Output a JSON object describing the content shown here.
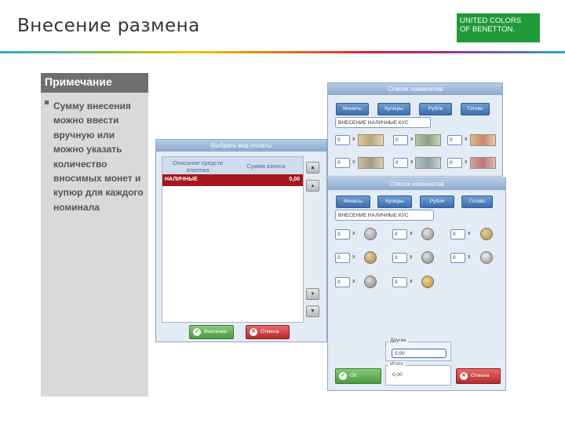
{
  "slide": {
    "title": "Внесение размена"
  },
  "logo": {
    "line1": "UNITED COLORS",
    "line2": "OF BENETTON."
  },
  "note": {
    "heading": "Примечание",
    "text": "Сумму внесения можно ввести вручную или можно указать количество вносимых монет и купюр для каждого номинала"
  },
  "payment_window": {
    "title": "Выбрать вид оплаты",
    "col_method": "Описание средств платежа",
    "col_amount": "Сумма взноса",
    "row_name": "НАЛИЧНЫЕ",
    "row_value": "0,00",
    "scroll_up": "▲",
    "scroll_pgup": "▴",
    "scroll_pgdn": "▾",
    "scroll_down": "▼",
    "add_label": "Внесение",
    "cancel_label": "Отмена"
  },
  "notes_window": {
    "title": "Список номиналов",
    "tabs": [
      "Монеты",
      "Купюры",
      "Рубли",
      "Готово"
    ],
    "field": "ВНЕСЕНИЕ НАЛИЧНЫЕ КУС",
    "qty": "0"
  },
  "coins_window": {
    "title": "Список номиналов",
    "tabs": [
      "Монеты",
      "Купюры",
      "Рубли",
      "Готово"
    ],
    "field": "ВНЕСЕНИЕ НАЛИЧНЫЕ КУС",
    "qty": "0",
    "other_label": "Другие",
    "other_value": "0,00",
    "total_label": "Итого",
    "total_value": "0,00",
    "ok_label": "ОК",
    "cancel_label": "Отмена"
  },
  "colors": {
    "accent_green": "#1f9a3a",
    "selected_row": "#a6171c"
  }
}
